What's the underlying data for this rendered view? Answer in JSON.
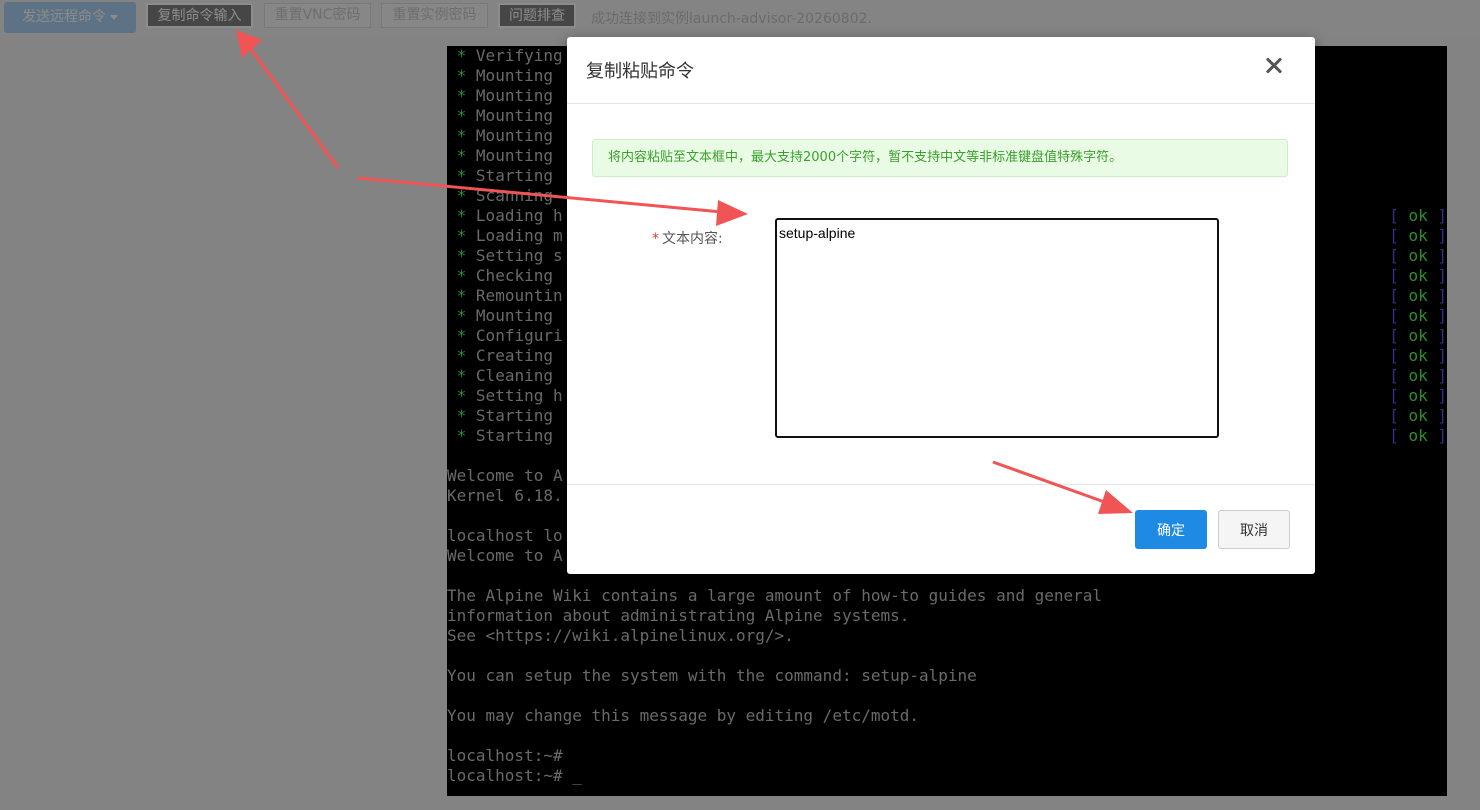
{
  "toolbar": {
    "send_remote_command": "发送远程命令",
    "copy_command_input": "复制命令输入",
    "reset_vnc_password": "重置VNC密码",
    "reset_instance_password": "重置实例密码",
    "troubleshoot": "问题排查",
    "status": "成功连接到实例launch-advisor-20260802."
  },
  "terminal": {
    "boot_lines": [
      {
        "text": "Verifying",
        "ok": false
      },
      {
        "text": "Mounting",
        "ok": false
      },
      {
        "text": "Mounting",
        "ok": false
      },
      {
        "text": "Mounting",
        "ok": false
      },
      {
        "text": "Mounting",
        "ok": false
      },
      {
        "text": "Mounting",
        "ok": false
      },
      {
        "text": "Starting",
        "ok": false
      },
      {
        "text": "Scanning",
        "ok": false
      },
      {
        "text": "Loading h",
        "ok": true
      },
      {
        "text": "Loading m",
        "ok": true
      },
      {
        "text": "Setting s",
        "ok": true
      },
      {
        "text": "Checking",
        "ok": true
      },
      {
        "text": "Remountin",
        "ok": true
      },
      {
        "text": "Mounting",
        "ok": true
      },
      {
        "text": "Configuri",
        "ok": true
      },
      {
        "text": "Creating",
        "ok": true
      },
      {
        "text": "Cleaning",
        "ok": true
      },
      {
        "text": "Setting h",
        "ok": true
      },
      {
        "text": "Starting",
        "ok": true
      },
      {
        "text": "Starting",
        "ok": true
      }
    ],
    "ok_word": "ok",
    "star": "*",
    "welcome_1": "Welcome to A",
    "kernel": "Kernel 6.18.",
    "localhost_login": "localhost lo",
    "welcome_2": "Welcome to A",
    "wiki_1": "The Alpine Wiki contains a large amount of how-to guides and general",
    "wiki_2": "information about administrating Alpine systems.",
    "wiki_3": "See <https://wiki.alpinelinux.org/>.",
    "setup_hint": "You can setup the system with the command: setup-alpine",
    "motd_hint": "You may change this message by editing /etc/motd.",
    "prompt_1": "localhost:~#",
    "prompt_2": "localhost:~# _"
  },
  "modal": {
    "title": "复制粘贴命令",
    "info": "将内容粘贴至文本框中，最大支持2000个字符，暂不支持中文等非标准键盘值特殊字符。",
    "required_mark": "*",
    "field_label": "文本内容:",
    "field_value": "setup-alpine",
    "confirm": "确定",
    "cancel": "取消"
  },
  "colors": {
    "primary_button": "#1f8ae3",
    "alert_bg": "#eafbe5",
    "alert_text": "#39a12c",
    "arrow": "#f05454",
    "terminal_ok": "#55ff55"
  }
}
